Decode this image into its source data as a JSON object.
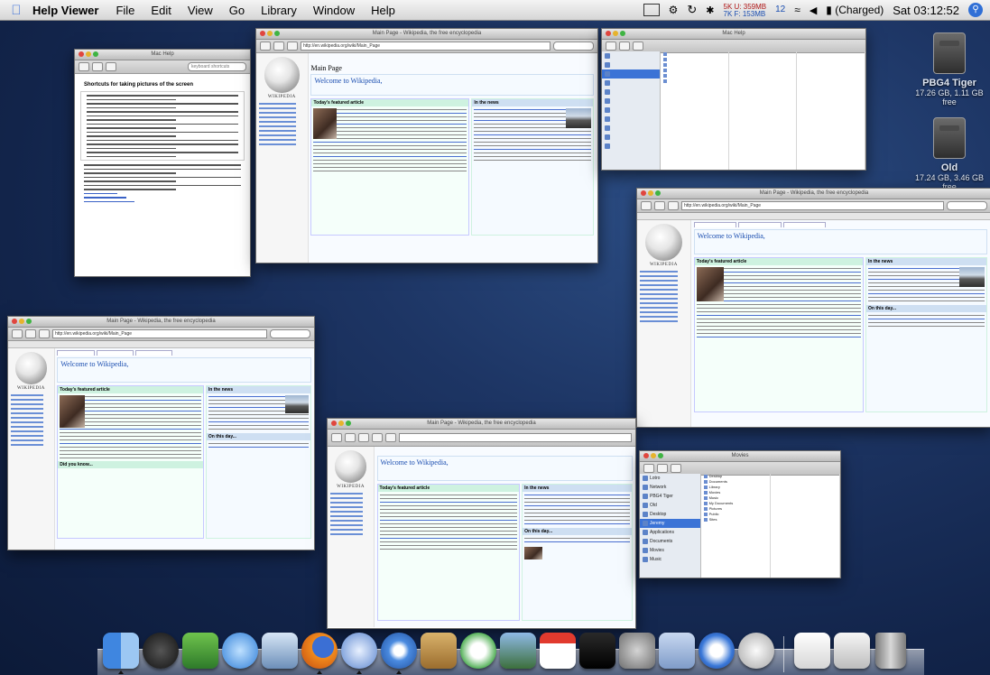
{
  "menubar": {
    "app_name": "Help Viewer",
    "menus": [
      "File",
      "Edit",
      "View",
      "Go",
      "Library",
      "Window",
      "Help"
    ],
    "status": {
      "mem_top": "5K  U: 359MB",
      "mem_bottom": "7K  F: 153MB",
      "mem_count": "12",
      "battery": "(Charged)",
      "clock": "Sat 03:12:52"
    }
  },
  "desktop": {
    "disks": [
      {
        "name": "PBG4 Tiger",
        "detail": "17.26 GB, 1.11 GB free"
      },
      {
        "name": "Old",
        "detail": "17.24 GB, 3.46 GB free"
      }
    ]
  },
  "windows": {
    "help": {
      "title": "Mac Help",
      "search_placeholder": "keyboard shortcuts",
      "heading": "Shortcuts for taking pictures of the screen"
    },
    "safari_main": {
      "title": "Main Page - Wikipedia, the free encyclopedia",
      "url": "http://en.wikipedia.org/wiki/Main_Page",
      "page_title": "Main Page",
      "welcome": "Welcome to Wikipedia,",
      "featured": "Today's featured article",
      "news": "In the news"
    },
    "finder_top": {
      "title": "Mac Help"
    },
    "firefox_right": {
      "title": "Main Page - Wikipedia, the free encyclopedia",
      "url": "http://en.wikipedia.org/wiki/Main_Page",
      "welcome": "Welcome to Wikipedia,",
      "featured": "Today's featured article",
      "news": "In the news",
      "onthisday": "On this day..."
    },
    "firefox_left": {
      "title": "Main Page - Wikipedia, the free encyclopedia",
      "url": "http://en.wikipedia.org/wiki/Main_Page",
      "welcome": "Welcome to Wikipedia,",
      "featured": "Today's featured article",
      "news": "In the news",
      "onthisday": "On this day...",
      "didyouknow": "Did you know..."
    },
    "camino_center": {
      "title": "Main Page - Wikipedia, the free encyclopedia",
      "welcome": "Welcome to Wikipedia,",
      "featured": "Today's featured article",
      "news": "In the news",
      "onthisday": "On this day..."
    },
    "finder_bottom": {
      "title": "Movies",
      "sidebar": [
        "Lotro",
        "Network",
        "PBG4 Tiger",
        "Old",
        "Desktop",
        "Jeremy",
        "Applications",
        "Documents",
        "Movies",
        "Music",
        "Pictures"
      ],
      "items": [
        "Desktop",
        "Documents",
        "Library",
        "Movies",
        "Music",
        "My Documents",
        "Pictures",
        "Public",
        "Sites"
      ]
    }
  },
  "dock": {
    "apps": [
      "Finder",
      "Dashboard",
      "iChat",
      "Safari",
      "Mail",
      "Firefox",
      "Camino",
      "Safari",
      "Address Book",
      "iTunes",
      "iPhoto",
      "iCal",
      "Terminal",
      "System Preferences",
      "Preview",
      "Internet Explorer",
      "Network Utility",
      "Documents",
      "Text",
      "Trash"
    ]
  }
}
